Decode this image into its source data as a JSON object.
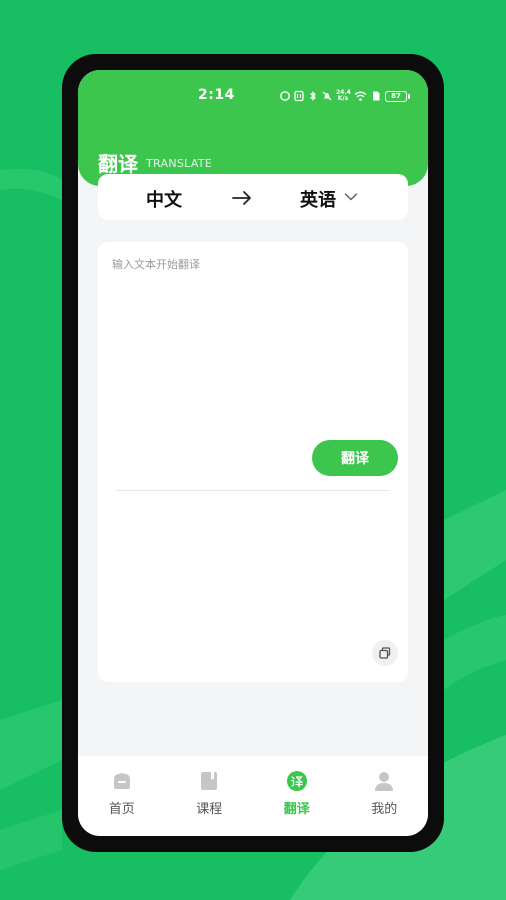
{
  "status_bar": {
    "time": "2:14",
    "speed_value": "24.4",
    "speed_unit": "K/s",
    "battery": "87"
  },
  "header": {
    "title": "翻译",
    "subtitle": "TRANSLATE"
  },
  "language_bar": {
    "source": "中文",
    "target": "英语"
  },
  "translator": {
    "input_value": "",
    "input_placeholder": "输入文本开始翻译",
    "translate_label": "翻译",
    "result": ""
  },
  "tabs": [
    {
      "label": "首页",
      "icon": "home-icon",
      "active": false
    },
    {
      "label": "课程",
      "icon": "book-icon",
      "active": false
    },
    {
      "label": "翻译",
      "icon": "translate-icon",
      "active": true
    },
    {
      "label": "我的",
      "icon": "user-icon",
      "active": false
    }
  ],
  "colors": {
    "background": "#17bf62",
    "accent": "#3cc64e",
    "inactive_icon": "#c6c6c6"
  }
}
